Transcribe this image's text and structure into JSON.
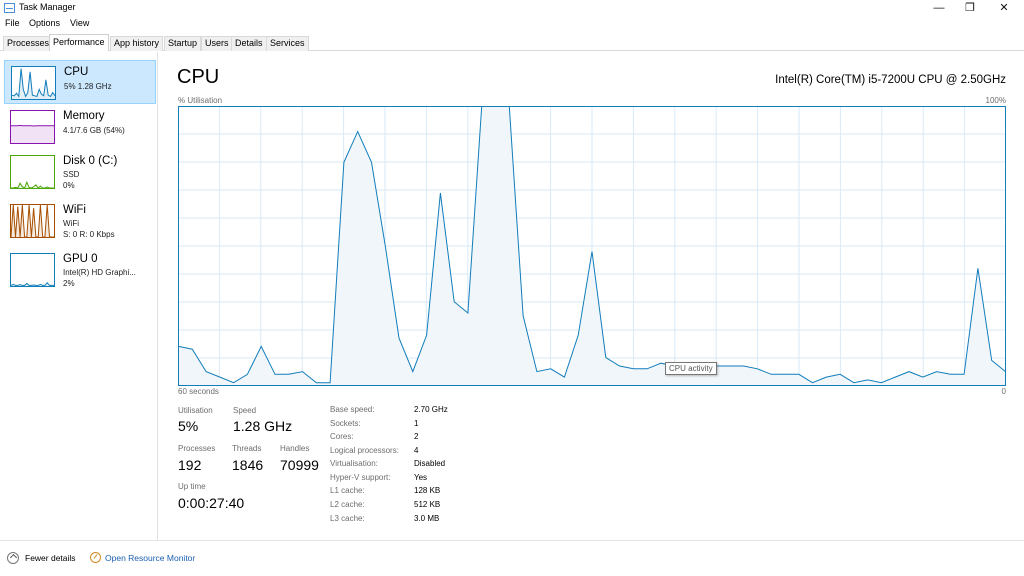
{
  "window": {
    "title": "Task Manager",
    "controls": {
      "minimize": "—",
      "restore": "❐",
      "close": "✕"
    },
    "icon": "task-manager-icon"
  },
  "menu": [
    "File",
    "Options",
    "View"
  ],
  "tabs": [
    "Processes",
    "Performance",
    "App history",
    "Startup",
    "Users",
    "Details",
    "Services"
  ],
  "active_tab": "Performance",
  "sidebar": [
    {
      "name": "CPU",
      "sub1": "5% 1.28 GHz",
      "sub2": "",
      "color": "#117dbb",
      "selected": true,
      "spark": [
        12,
        10,
        18,
        8,
        95,
        30,
        8,
        20,
        85,
        12,
        10,
        8,
        30,
        15,
        10,
        60,
        12,
        8,
        20,
        10
      ]
    },
    {
      "name": "Memory",
      "sub1": "4.1/7.6 GB (54%)",
      "sub2": "",
      "color": "#8b12ae",
      "selected": false,
      "spark": [
        54,
        54,
        54,
        54,
        55,
        54,
        54,
        54,
        54,
        54,
        53,
        54,
        54,
        54,
        54,
        54,
        54,
        54,
        54,
        54
      ]
    },
    {
      "name": "Disk 0 (C:)",
      "sub1": "SSD",
      "sub2": "0%",
      "color": "#4da60c",
      "selected": false,
      "spark": [
        0,
        0,
        2,
        0,
        15,
        4,
        0,
        18,
        2,
        0,
        4,
        10,
        0,
        6,
        0,
        0,
        3,
        0,
        0,
        0
      ]
    },
    {
      "name": "WiFi",
      "sub1": "WiFi",
      "sub2": "S: 0  R: 0 Kbps",
      "color": "#a74f01",
      "selected": false,
      "spark": [
        0,
        100,
        0,
        95,
        0,
        100,
        0,
        0,
        100,
        0,
        90,
        0,
        0,
        100,
        0,
        0,
        100,
        0,
        0,
        0
      ]
    },
    {
      "name": "GPU 0",
      "sub1": "Intel(R) HD Graphi...",
      "sub2": "2%",
      "color": "#117dbb",
      "selected": false,
      "spark": [
        2,
        5,
        2,
        2,
        4,
        2,
        2,
        8,
        2,
        2,
        3,
        2,
        2,
        5,
        2,
        2,
        10,
        2,
        2,
        2
      ]
    }
  ],
  "main": {
    "title": "CPU",
    "model": "Intel(R) Core(TM) i5-7200U CPU @ 2.50GHz",
    "util_label": "% Utilisation",
    "util_max": "100%",
    "x_left": "60 seconds",
    "x_right": "0",
    "tooltip": "CPU activity"
  },
  "chart_data": {
    "type": "area",
    "ylim": [
      0,
      100
    ],
    "xlim": [
      60,
      0
    ],
    "xlabel": "60 seconds",
    "ylabel": "% Utilisation",
    "grid": true,
    "series": [
      {
        "color": "#117dbb",
        "x": [
          60,
          59,
          58,
          57,
          56,
          55,
          54,
          53,
          52,
          51,
          50,
          49,
          48,
          47,
          46,
          45,
          44,
          43,
          42,
          41,
          40,
          39,
          38,
          37,
          36,
          35,
          34,
          33,
          32,
          31,
          30,
          29,
          28,
          27,
          26,
          25,
          24,
          23,
          22,
          21,
          20,
          19,
          18,
          17,
          16,
          15,
          14,
          13,
          12,
          11,
          10,
          9,
          8,
          7,
          6,
          5,
          4,
          3,
          2,
          1,
          0
        ],
        "values": [
          14,
          13,
          5,
          3,
          1,
          4,
          14,
          4,
          4,
          5,
          1,
          1,
          80,
          91,
          80,
          50,
          17,
          5,
          18,
          69,
          30,
          26,
          100,
          100,
          100,
          25,
          5,
          6,
          3,
          18,
          48,
          10,
          7,
          6,
          6,
          8,
          7,
          5,
          4,
          7,
          7,
          7,
          6,
          4,
          4,
          4,
          1,
          3,
          4,
          1,
          2,
          1,
          3,
          5,
          3,
          5,
          4,
          4,
          42,
          9,
          5
        ]
      }
    ]
  },
  "stats": {
    "utilisation": {
      "label": "Utilisation",
      "value": "5%"
    },
    "speed": {
      "label": "Speed",
      "value": "1.28 GHz"
    },
    "processes": {
      "label": "Processes",
      "value": "192"
    },
    "threads": {
      "label": "Threads",
      "value": "1846"
    },
    "handles": {
      "label": "Handles",
      "value": "70999"
    },
    "uptime": {
      "label": "Up time",
      "value": "0:00:27:40"
    }
  },
  "specs": [
    {
      "label": "Base speed:",
      "value": "2.70 GHz"
    },
    {
      "label": "Sockets:",
      "value": "1"
    },
    {
      "label": "Cores:",
      "value": "2"
    },
    {
      "label": "Logical processors:",
      "value": "4"
    },
    {
      "label": "Virtualisation:",
      "value": "Disabled"
    },
    {
      "label": "Hyper-V support:",
      "value": "Yes"
    },
    {
      "label": "L1 cache:",
      "value": "128 KB"
    },
    {
      "label": "L2 cache:",
      "value": "512 KB"
    },
    {
      "label": "L3 cache:",
      "value": "3.0 MB"
    }
  ],
  "footer": {
    "fewer_details": "Fewer details",
    "open_resource_monitor": "Open Resource Monitor"
  }
}
